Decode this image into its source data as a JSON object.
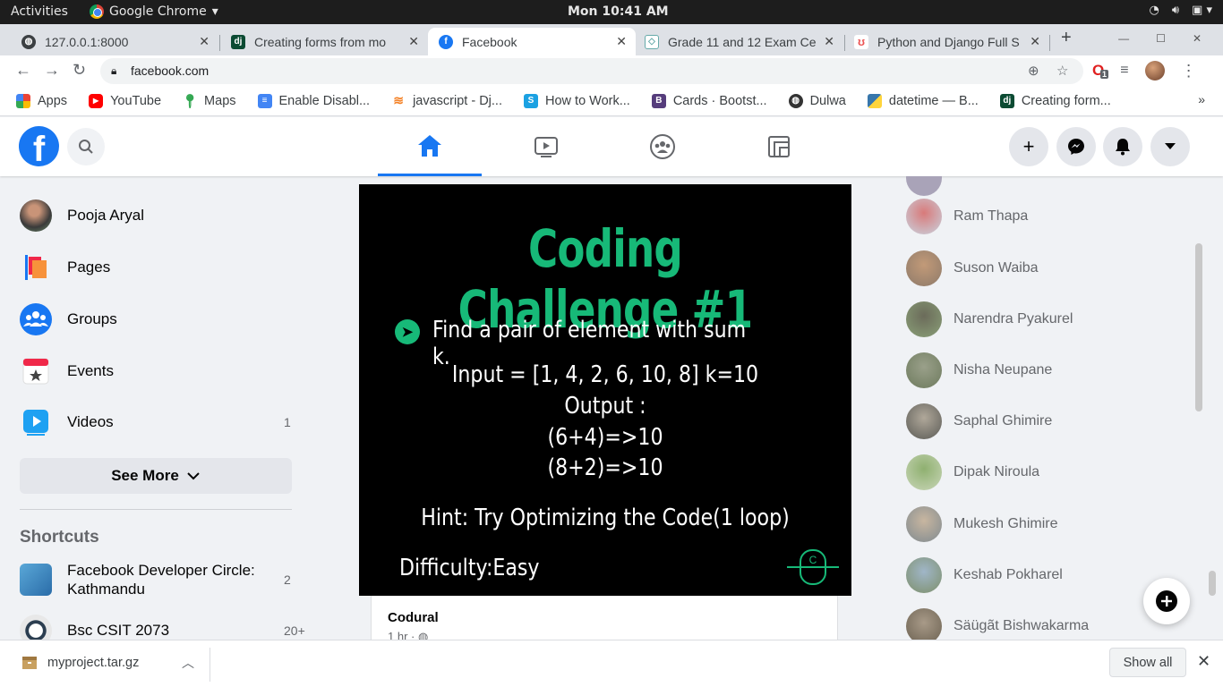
{
  "os": {
    "activities": "Activities",
    "app_name": "Google Chrome",
    "clock": "Mon 10:41 AM"
  },
  "tabs": [
    {
      "title": "127.0.0.1:8000",
      "favicon": "globe-icon",
      "active": false
    },
    {
      "title": "Creating forms from mo",
      "favicon": "dj",
      "active": false
    },
    {
      "title": "Facebook",
      "favicon": "facebook-icon",
      "active": true
    },
    {
      "title": "Grade 11 and 12 Exam Ce",
      "favicon": "book-icon",
      "active": false
    },
    {
      "title": "Python and Django Full S",
      "favicon": "udemy-icon",
      "active": false
    }
  ],
  "address": {
    "url": "facebook.com",
    "extension_badge": "1"
  },
  "bookmarks": [
    {
      "label": "Apps",
      "icon": "apps-grid-icon"
    },
    {
      "label": "YouTube",
      "icon": "youtube-icon",
      "color": "#ff0000"
    },
    {
      "label": "Maps",
      "icon": "maps-pin-icon",
      "color": "#34a853"
    },
    {
      "label": "Enable Disabl...",
      "icon": "doc-icon",
      "color": "#4285f4"
    },
    {
      "label": "javascript - Dj...",
      "icon": "stackoverflow-icon",
      "color": "#f48024"
    },
    {
      "label": "How to Work...",
      "icon": "s-icon",
      "color": "#1ba1e2"
    },
    {
      "label": "Cards · Bootst...",
      "icon": "bootstrap-icon",
      "color": "#563d7c"
    },
    {
      "label": "Dulwa",
      "icon": "globe-icon",
      "color": "#333333"
    },
    {
      "label": "datetime — B...",
      "icon": "python-icon",
      "color": "#3776ab"
    },
    {
      "label": "Creating form...",
      "icon": "dj",
      "color": "#0c4b33"
    }
  ],
  "sidebar": {
    "items": [
      {
        "label": "Pooja Aryal",
        "icon": "profile-avatar",
        "count": ""
      },
      {
        "label": "Pages",
        "icon": "flag-icon",
        "count": ""
      },
      {
        "label": "Groups",
        "icon": "groups-icon",
        "count": ""
      },
      {
        "label": "Events",
        "icon": "calendar-icon",
        "count": ""
      },
      {
        "label": "Videos",
        "icon": "video-icon",
        "count": "1"
      }
    ],
    "see_more": "See More",
    "shortcuts_title": "Shortcuts",
    "shortcuts": [
      {
        "label": "Facebook Developer Circle: Kathmandu",
        "count": "2"
      },
      {
        "label": "Bsc CSIT 2073",
        "count": "20+"
      }
    ]
  },
  "post": {
    "image_title": "Coding Challenge #1",
    "problem": "Find a pair of element with sum k.",
    "input": "Input = [1, 4, 2, 6, 10, 8]  k=10",
    "output_label": "Output :",
    "output_1": "(6+4)=>10",
    "output_2": "(8+2)=>10",
    "hint": "Hint: Try Optimizing the Code(1 loop)",
    "difficulty": "Difficulty:Easy",
    "logo_letter": "C",
    "author": "Codural",
    "time": "1 hr ·"
  },
  "contacts": [
    "Ram Thapa",
    "Suson Waiba",
    "Narendra Pyakurel",
    "Nisha Neupane",
    "Saphal Ghimire",
    "Dipak Niroula",
    "Mukesh Ghimire",
    "Keshab Pokharel",
    "Säügãt Bishwakarma"
  ],
  "download": {
    "filename": "myproject.tar.gz",
    "show_all": "Show all"
  },
  "colors": {
    "facebook_blue": "#1877f2",
    "challenge_green": "#17b978"
  }
}
